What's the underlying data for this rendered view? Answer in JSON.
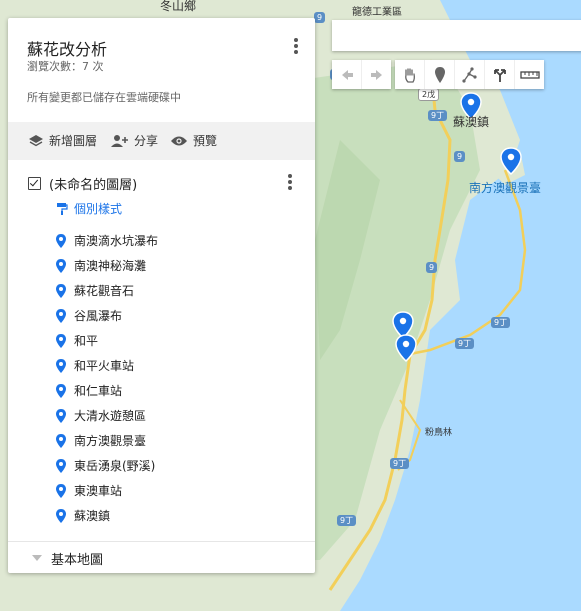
{
  "panel": {
    "title": "蘇花改分析",
    "views": "瀏覽次數：7 次",
    "saved": "所有變更都已儲存在雲端硬碟中",
    "toolbar": {
      "add_layer": "新增圖層",
      "share": "分享",
      "preview": "預覽"
    },
    "layer": {
      "name": "(未命名的圖層)",
      "style_link": "個別樣式",
      "items": [
        "南澳滴水坑瀑布",
        "南澳神秘海灘",
        "蘇花觀音石",
        "谷風瀑布",
        "和平",
        "和平火車站",
        "和仁車站",
        "大清水遊憩區",
        "南方澳觀景臺",
        "東岳湧泉(野溪)",
        "東澳車站",
        "蘇澳鎮"
      ]
    },
    "basemap": "基本地圖"
  },
  "map": {
    "labels": {
      "top_left": "冬山鄉",
      "top_mid": "龍德工業區",
      "suao": "蘇澳鎮",
      "nanfangao": "南方澳觀景臺",
      "fennalin": "粉鳥林"
    },
    "shields": [
      "9",
      "9",
      "9",
      "9",
      "9丁",
      "9丁",
      "9丁",
      "9丁",
      "9丁",
      "2戊"
    ],
    "colors": {
      "land": "#e7ecdc",
      "forest": "#cfe3c5",
      "water": "#aadaff",
      "road": "#f7d14c",
      "marker": "#1a73e8"
    }
  },
  "icons": {
    "undo": "undo-icon",
    "redo": "redo-icon",
    "pan": "hand-icon",
    "marker": "marker-icon",
    "line": "draw-line-icon",
    "route": "directions-icon",
    "ruler": "ruler-icon"
  }
}
